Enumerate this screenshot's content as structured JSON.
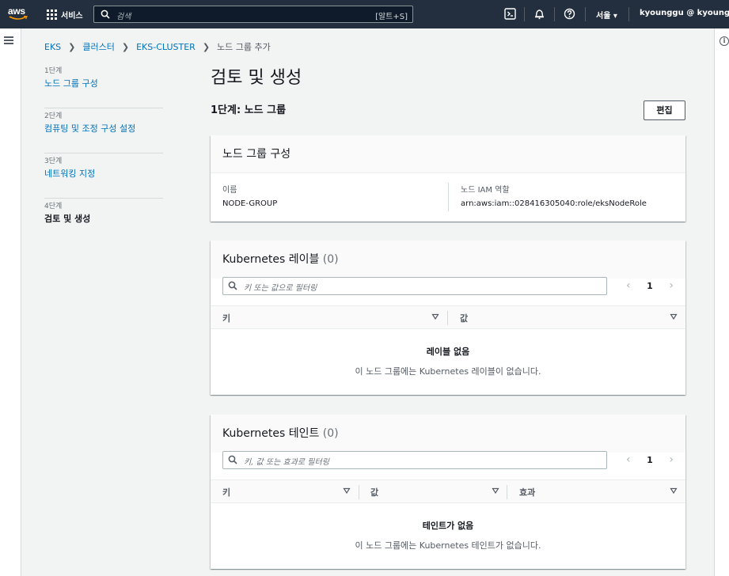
{
  "topnav": {
    "logo": "aws",
    "services_label": "서비스",
    "search_placeholder": "검색",
    "search_shortcut": "[알트+S]",
    "region": "서울 ▾",
    "account": "kyounggu @ kyounggu ▾",
    "icons": [
      "cloudshell-icon",
      "bell-icon",
      "help-icon"
    ]
  },
  "breadcrumb": {
    "items": [
      "EKS",
      "클러스터",
      "EKS-CLUSTER"
    ],
    "current": "노드 그룹 추가"
  },
  "steps": [
    {
      "num": "1단계",
      "name": "노드 그룹 구성"
    },
    {
      "num": "2단계",
      "name": "컴퓨팅 및 조정 구성 설정"
    },
    {
      "num": "3단계",
      "name": "네트워킹 지정"
    },
    {
      "num": "4단계",
      "name": "검토 및 생성"
    }
  ],
  "main": {
    "title": "검토 및 생성",
    "step_heading": "1단계: 노드 그룹",
    "edit_label": "편집"
  },
  "config_panel": {
    "title": "노드 그룹 구성",
    "name_label": "이름",
    "name_value": "NODE-GROUP",
    "role_label": "노드 IAM 역할",
    "role_value": "arn:aws:iam::028416305040:role/eksNodeRole"
  },
  "labels_panel": {
    "title": "Kubernetes 레이블",
    "count": "(0)",
    "filter_placeholder": "키 또는 값으로 필터링",
    "page": "1",
    "columns": [
      "키",
      "값"
    ],
    "empty_title": "레이블 없음",
    "empty_desc": "이 노드 그룹에는 Kubernetes 레이블이 없습니다."
  },
  "taints_panel": {
    "title": "Kubernetes 테인트",
    "count": "(0)",
    "filter_placeholder": "키, 값 또는 효과로 필터링",
    "page": "1",
    "columns": [
      "키",
      "값",
      "효과"
    ],
    "empty_title": "테인트가 없음",
    "empty_desc": "이 노드 그룹에는 Kubernetes 테인트가 없습니다."
  },
  "colors": {
    "nav_bg": "#232f3e",
    "link": "#0073bb",
    "page_bg": "#f2f3f3"
  }
}
